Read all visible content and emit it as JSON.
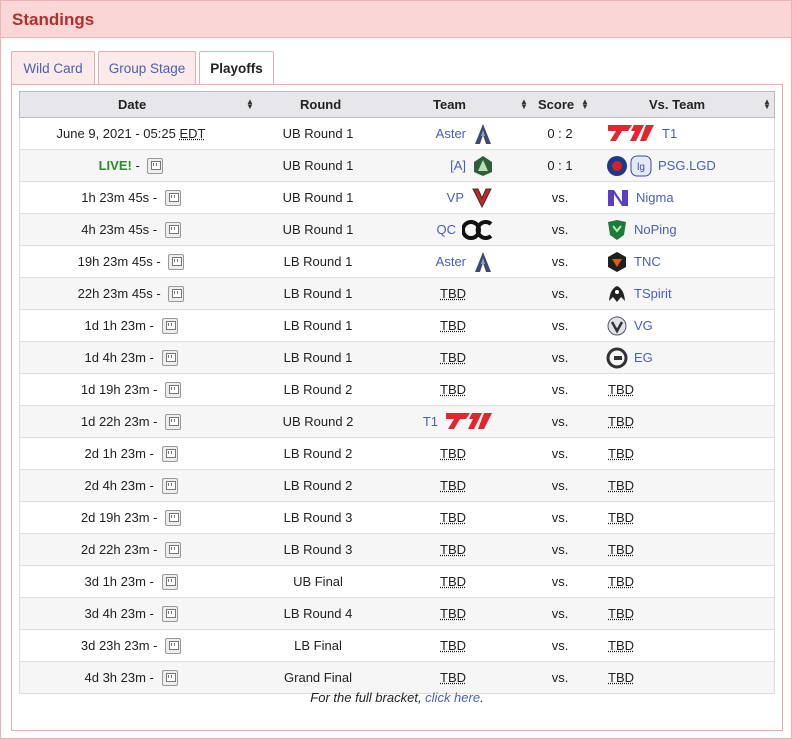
{
  "header": {
    "title": "Standings"
  },
  "tabs": [
    {
      "label": "Wild Card"
    },
    {
      "label": "Group Stage"
    },
    {
      "label": "Playoffs"
    }
  ],
  "table": {
    "columns": {
      "date": "Date",
      "round": "Round",
      "team": "Team",
      "score": "Score",
      "vs_team": "Vs. Team"
    },
    "rows": [
      {
        "date": "June 9, 2021 - 05:25",
        "tz": "EDT",
        "round": "UB Round 1",
        "team1": "Aster",
        "logo1": "aster",
        "score": "0 : 2",
        "team2": "T1",
        "logo2": "t1"
      },
      {
        "date": "LIVE!",
        "live": true,
        "round": "UB Round 1",
        "team1": "[A]",
        "logo1": "alliance",
        "score": "0 : 1",
        "team2": "PSG.LGD",
        "logo2": "psglgd"
      },
      {
        "date": "1h 23m 45s",
        "round": "UB Round 1",
        "team1": "VP",
        "logo1": "vp",
        "score": "vs.",
        "team2": "Nigma",
        "logo2": "nigma"
      },
      {
        "date": "4h 23m 45s",
        "round": "UB Round 1",
        "team1": "QC",
        "logo1": "qc",
        "score": "vs.",
        "team2": "NoPing",
        "logo2": "noping"
      },
      {
        "date": "19h 23m 45s",
        "round": "LB Round 1",
        "team1": "Aster",
        "logo1": "aster",
        "score": "vs.",
        "team2": "TNC",
        "logo2": "tnc"
      },
      {
        "date": "22h 23m 45s",
        "round": "LB Round 1",
        "team1": "TBD",
        "score": "vs.",
        "team2": "TSpirit",
        "logo2": "tspirit"
      },
      {
        "date": "1d 1h 23m",
        "round": "LB Round 1",
        "team1": "TBD",
        "score": "vs.",
        "team2": "VG",
        "logo2": "vg"
      },
      {
        "date": "1d 4h 23m",
        "round": "LB Round 1",
        "team1": "TBD",
        "score": "vs.",
        "team2": "EG",
        "logo2": "eg"
      },
      {
        "date": "1d 19h 23m",
        "round": "LB Round 2",
        "team1": "TBD",
        "score": "vs.",
        "team2": "TBD"
      },
      {
        "date": "1d 22h 23m",
        "round": "UB Round 2",
        "team1": "T1",
        "logo1": "t1",
        "score": "vs.",
        "team2": "TBD"
      },
      {
        "date": "2d 1h 23m",
        "round": "LB Round 2",
        "team1": "TBD",
        "score": "vs.",
        "team2": "TBD"
      },
      {
        "date": "2d 4h 23m",
        "round": "LB Round 2",
        "team1": "TBD",
        "score": "vs.",
        "team2": "TBD"
      },
      {
        "date": "2d 19h 23m",
        "round": "LB Round 3",
        "team1": "TBD",
        "score": "vs.",
        "team2": "TBD"
      },
      {
        "date": "2d 22h 23m",
        "round": "LB Round 3",
        "team1": "TBD",
        "score": "vs.",
        "team2": "TBD"
      },
      {
        "date": "3d 1h 23m",
        "round": "UB Final",
        "team1": "TBD",
        "score": "vs.",
        "team2": "TBD"
      },
      {
        "date": "3d 4h 23m",
        "round": "LB Round 4",
        "team1": "TBD",
        "score": "vs.",
        "team2": "TBD"
      },
      {
        "date": "3d 23h 23m",
        "round": "LB Final",
        "team1": "TBD",
        "score": "vs.",
        "team2": "TBD"
      },
      {
        "date": "4d 3h 23m",
        "round": "Grand Final",
        "team1": "TBD",
        "score": "vs.",
        "team2": "TBD"
      }
    ]
  },
  "footer": {
    "prefix": "For the full bracket, ",
    "link": "click here",
    "suffix": "."
  },
  "colors": {
    "header_bg": "#fbd6d6",
    "title": "#b03030",
    "link": "#4a5fb8",
    "live": "#2e8b2e",
    "t1_red": "#e0262f"
  }
}
